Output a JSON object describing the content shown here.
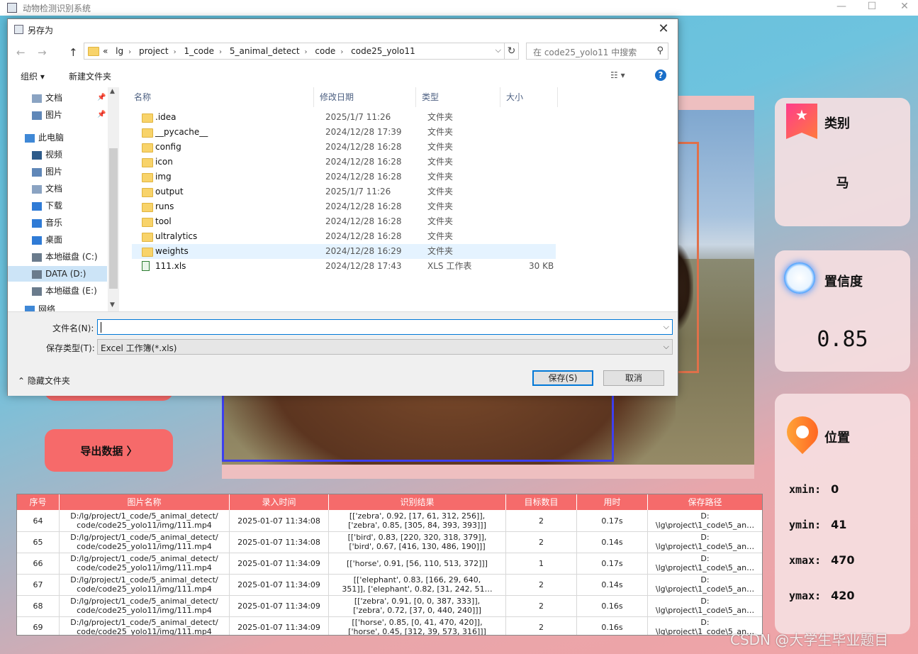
{
  "app": {
    "title": "动物检测识别系统",
    "window_controls": [
      "—",
      "☐",
      "✕"
    ]
  },
  "sidebar": {
    "export_button": "导出数据 〉"
  },
  "cards": {
    "category": {
      "title": "类别",
      "value": "马"
    },
    "confidence": {
      "title": "置信度",
      "value": "0.85"
    },
    "position": {
      "title": "位置",
      "rows": [
        {
          "label": "xmin:",
          "value": "0"
        },
        {
          "label": "ymin:",
          "value": "41"
        },
        {
          "label": "xmax:",
          "value": "470"
        },
        {
          "label": "ymax:",
          "value": "420"
        }
      ]
    }
  },
  "table": {
    "headers": [
      "序号",
      "图片名称",
      "录入时间",
      "识别结果",
      "目标数目",
      "用时",
      "保存路径"
    ],
    "rows": [
      {
        "id": "64",
        "name": "D:/lg/project/1_code/5_animal_detect/\ncode/code25_yolo11/img/111.mp4",
        "time": "2025-01-07 11:34:08",
        "result": "[['zebra', 0.92, [17, 61, 312, 256]],\n['zebra', 0.85, [305, 84, 393, 393]]]",
        "count": "2",
        "cost": "0.17s",
        "path": "D:\n\\lg\\project\\1_code\\5_an…"
      },
      {
        "id": "65",
        "name": "D:/lg/project/1_code/5_animal_detect/\ncode/code25_yolo11/img/111.mp4",
        "time": "2025-01-07 11:34:08",
        "result": "[['bird', 0.83, [220, 320, 318, 379]],\n['bird', 0.67, [416, 130, 486, 190]]]",
        "count": "2",
        "cost": "0.14s",
        "path": "D:\n\\lg\\project\\1_code\\5_an…"
      },
      {
        "id": "66",
        "name": "D:/lg/project/1_code/5_animal_detect/\ncode/code25_yolo11/img/111.mp4",
        "time": "2025-01-07 11:34:09",
        "result": "[['horse', 0.91, [56, 110, 513, 372]]]",
        "count": "1",
        "cost": "0.17s",
        "path": "D:\n\\lg\\project\\1_code\\5_an…"
      },
      {
        "id": "67",
        "name": "D:/lg/project/1_code/5_animal_detect/\ncode/code25_yolo11/img/111.mp4",
        "time": "2025-01-07 11:34:09",
        "result": "[['elephant', 0.83, [166, 29, 640,\n351]], ['elephant', 0.82, [31, 242, 51…",
        "count": "2",
        "cost": "0.14s",
        "path": "D:\n\\lg\\project\\1_code\\5_an…"
      },
      {
        "id": "68",
        "name": "D:/lg/project/1_code/5_animal_detect/\ncode/code25_yolo11/img/111.mp4",
        "time": "2025-01-07 11:34:09",
        "result": "[['zebra', 0.91, [0, 0, 387, 333]],\n['zebra', 0.72, [37, 0, 440, 240]]]",
        "count": "2",
        "cost": "0.16s",
        "path": "D:\n\\lg\\project\\1_code\\5_an…"
      },
      {
        "id": "69",
        "name": "D:/lg/project/1_code/5_animal_detect/\ncode/code25_yolo11/img/111.mp4",
        "time": "2025-01-07 11:34:09",
        "result": "[['horse', 0.85, [0, 41, 470, 420]],\n['horse', 0.45, [312, 39, 573, 316]]]",
        "count": "2",
        "cost": "0.16s",
        "path": "D:\n\\lg\\project\\1_code\\5_an…"
      }
    ]
  },
  "dialog": {
    "title": "另存为",
    "close": "✕",
    "nav": {
      "back": "←",
      "forward": "→",
      "up": "↑"
    },
    "breadcrumbs": [
      "«",
      "lg",
      "project",
      "1_code",
      "5_animal_detect",
      "code",
      "code25_yolo11"
    ],
    "refresh": "↻",
    "search_placeholder": "在 code25_yolo11 中搜索",
    "toolbar": {
      "organize": "组织 ▾",
      "new_folder": "新建文件夹",
      "view": "☷ ▾",
      "help": "?"
    },
    "nav_items": [
      {
        "label": "文档",
        "pinned": "📌"
      },
      {
        "label": "图片",
        "pinned": "📌"
      },
      {
        "label": "此电脑"
      },
      {
        "label": "视频"
      },
      {
        "label": "图片"
      },
      {
        "label": "文档"
      },
      {
        "label": "下载"
      },
      {
        "label": "音乐"
      },
      {
        "label": "桌面"
      },
      {
        "label": "本地磁盘 (C:)"
      },
      {
        "label": "DATA (D:)"
      },
      {
        "label": "本地磁盘 (E:)"
      },
      {
        "label": "网络"
      }
    ],
    "columns": [
      "名称",
      "修改日期",
      "类型",
      "大小"
    ],
    "files": [
      {
        "name": ".idea",
        "date": "2025/1/7 11:26",
        "type": "文件夹",
        "size": ""
      },
      {
        "name": "__pycache__",
        "date": "2024/12/28 17:39",
        "type": "文件夹",
        "size": ""
      },
      {
        "name": "config",
        "date": "2024/12/28 16:28",
        "type": "文件夹",
        "size": ""
      },
      {
        "name": "icon",
        "date": "2024/12/28 16:28",
        "type": "文件夹",
        "size": ""
      },
      {
        "name": "img",
        "date": "2024/12/28 16:28",
        "type": "文件夹",
        "size": ""
      },
      {
        "name": "output",
        "date": "2025/1/7 11:26",
        "type": "文件夹",
        "size": ""
      },
      {
        "name": "runs",
        "date": "2024/12/28 16:28",
        "type": "文件夹",
        "size": ""
      },
      {
        "name": "tool",
        "date": "2024/12/28 16:28",
        "type": "文件夹",
        "size": ""
      },
      {
        "name": "ultralytics",
        "date": "2024/12/28 16:28",
        "type": "文件夹",
        "size": ""
      },
      {
        "name": "weights",
        "date": "2024/12/28 16:29",
        "type": "文件夹",
        "size": ""
      },
      {
        "name": "111.xls",
        "date": "2024/12/28 17:43",
        "type": "XLS 工作表",
        "size": "30 KB"
      }
    ],
    "filename_label": "文件名(N):",
    "filename_value": "",
    "filetype_label": "保存类型(T):",
    "filetype_value": "Excel 工作簿(*.xls)",
    "save_button": "保存(S)",
    "cancel_button": "取消",
    "hide_folders": "隐藏文件夹"
  },
  "watermark": "CSDN @大学生毕业题目"
}
